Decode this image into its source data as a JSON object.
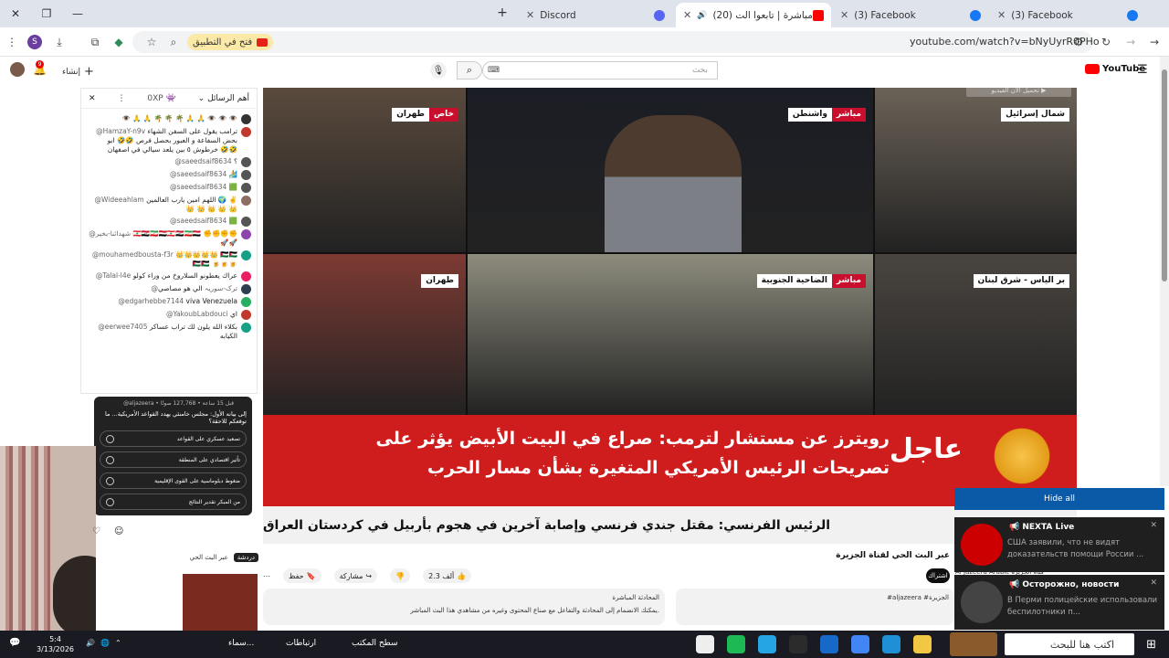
{
  "browser": {
    "tabs": [
      {
        "label": "(3) Facebook",
        "fav_color": "#1877f2",
        "active": false
      },
      {
        "label": "(3) Facebook",
        "fav_color": "#1877f2",
        "active": false
      },
      {
        "label": "(20) تغطية مباشرة | تابعوا الت...",
        "fav_color": "#ff0000",
        "active": true
      },
      {
        "label": "Discord",
        "fav_color": "#5865f2",
        "active": false
      }
    ],
    "url": "youtube.com/watch?v=bNyUyrR0PHo",
    "open_in_app": "فتح في التطبيق",
    "profile_letter": "S"
  },
  "youtube": {
    "search_placeholder": "بحث",
    "logo_text": "YouTube",
    "create_label": "إنشاء"
  },
  "chat": {
    "header_label": "أهم الرسائل",
    "messages": [
      {
        "author": "",
        "text": "👁️ 🙏 🙏 🌴 🌴 🌴 🙏 🙏 👁️ 👁️ 👁️",
        "color": "#333"
      },
      {
        "author": "@HamzaY-n9v",
        "text": "ترامب يقول على السفن الشهاء بحض السفاعة و العبور بحصل فرص 🤣🤣 ابو خرطوش ٥ بين يلعد سيالي في اصفهان 🤣🤣",
        "color": "#c0392b"
      },
      {
        "author": "@saeedsaif8634",
        "text": "؟",
        "color": "#555"
      },
      {
        "author": "@saeedsaif8634",
        "text": "🏄",
        "color": "#555"
      },
      {
        "author": "@saeedsaif8634",
        "text": "🟩",
        "color": "#555"
      },
      {
        "author": "@Wideeahlam",
        "text": "اللهم امين يارب العالمين 🌍 ✌️ 👑 👑 👑 👑 👑",
        "color": "#8d6e63"
      },
      {
        "author": "@saeedsaif8634",
        "text": "🟩",
        "color": "#555"
      },
      {
        "author": "@شهدائنا-بخير",
        "text": "🇱🇧🇮🇶🇮🇷🇾🇪🇱🇧🇮🇶🇮🇷🇾🇪 ✊✊✊✊ 🚀🚀",
        "color": "#8e44ad"
      },
      {
        "author": "@mouhamedbousta-f3r",
        "text": "👑👑👑👑👑 🇵🇸🇵🇸🇵🇸🇵🇸 🍺🍺🍺",
        "color": "#16a085"
      },
      {
        "author": "@Talal-l4e",
        "text": "عراك يعطونو السلاروخ من وراء كولو",
        "color": "#e91e63"
      },
      {
        "author": "@ترک-سوریہ",
        "text": "الي هو مصاصي",
        "color": "#2c3e50"
      },
      {
        "author": "@edgarhebbe7144",
        "text": "viva Venezuela",
        "color": "#27ae60"
      },
      {
        "author": "@YakoubLabdouci",
        "text": "اي",
        "color": "#c0392b"
      },
      {
        "author": "@eerwee7405",
        "text": "بكلاء الله يلون لك تراب عساكر الكيابه",
        "color": "#16a085"
      }
    ]
  },
  "poll": {
    "meta": "@aljazeera • قبل 15 ساعة • 127,768 صوتًا",
    "question": "إلى بيانه الأول: مجلس خامنئي يهدد القواعد الأمريكية... ما توقعكم للاحقة؟",
    "options": [
      "تصعيد عسكري على القواعد",
      "تأثير اقتصادي على المنطقة",
      "ضغوط دبلوماسية على القوى الإقليمية",
      "من المبكر تقدير النتائج"
    ]
  },
  "video": {
    "cells": [
      {
        "location": "طهران",
        "status": "خاص",
        "bg": "#5a4a3d"
      },
      {
        "location": "واشنطن",
        "status": "مباشر",
        "bg": "#1b1d25"
      },
      {
        "location": "شمال إسرائيل",
        "status": "",
        "bg": "#6b6257"
      },
      {
        "location": "طهران",
        "status": "",
        "bg": "#7d3a33"
      },
      {
        "location": "الضاحية الجنوبية",
        "status": "مباشر",
        "bg": "#8d8c7d"
      },
      {
        "location": "بر الياس - شرق لبنان",
        "status": "",
        "bg": "#4a4540"
      }
    ],
    "headline_1": "رويترز عن مستشار لترمب: صراع في البيت الأبيض يؤثر على",
    "headline_2": "تصريحات الرئيس الأمريكي المتغيرة بشأن مسار الحرب",
    "urgent": "عاجل",
    "ticker": "الرئيس الفرنسي: مقتل جندي فرنسي وإصابة آخرين في هجوم بأربيل في كردستان العراق",
    "overlay_tag": "تحميل الان الفيديو ▶"
  },
  "below": {
    "title": "عبر البث الحي لقناة الجزيرة",
    "subscribe": "اشتراك",
    "likes": "2.3 ألف",
    "share": "مشاركة",
    "save": "حفظ",
    "channel": "Al Jazeera Arabic قناة الجزيرة",
    "desc_left_title": "المحادثة المباشرة",
    "desc_left_text": "يمكنك الانضمام إلى المحادثة والتفاعل مع صناع المحتوى وغيره من مشاهدي هذا البث المباشر.",
    "desc_right_text": "#aljazeera #الجزيرة",
    "chat_send": "دردشة",
    "chat_channel": "عبر البث الحي"
  },
  "notifications": {
    "hide_all": "Hide all",
    "items": [
      {
        "title": "📢 NEXTA Live",
        "body": "США заявили, что не видят доказательств помощи России ...",
        "icon_color": "#cc0000"
      },
      {
        "title": "📢 Осторожно, новости",
        "body": "В Перми полицейские использовали беспилотники п...",
        "icon_color": "#444"
      }
    ]
  },
  "taskbar": {
    "search_placeholder": "اكتب هنا للبحث",
    "desktop_label": "سطح المكتب",
    "links_label": "ارتباطات",
    "temp": "سماء...",
    "date": "3/13/2026",
    "time": "5:4",
    "apps": [
      {
        "name": "explorer-icon",
        "color": "#f2c744"
      },
      {
        "name": "edge-icon",
        "color": "#1f8fd6"
      },
      {
        "name": "chrome-icon",
        "color": "#4285f4"
      },
      {
        "name": "mail-icon",
        "color": "#1769c7"
      },
      {
        "name": "notes-icon",
        "color": "#2b2b2b"
      },
      {
        "name": "telegram-icon",
        "color": "#26a5e4"
      },
      {
        "name": "spotify-icon",
        "color": "#1db954"
      },
      {
        "name": "openai-icon",
        "color": "#eeeeee"
      }
    ]
  }
}
